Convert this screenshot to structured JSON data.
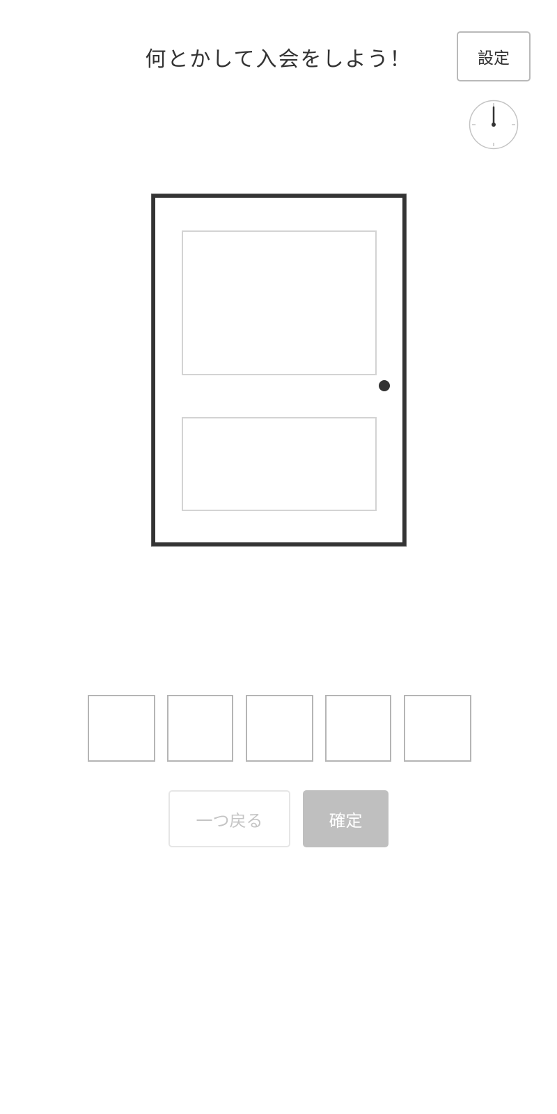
{
  "header": {
    "title": "何とかして入会をしよう！",
    "settings_label": "設定"
  },
  "code_input": {
    "slot_count": 5,
    "values": [
      "",
      "",
      "",
      "",
      ""
    ]
  },
  "actions": {
    "back_label": "一つ戻る",
    "confirm_label": "確定"
  },
  "colors": {
    "text": "#333333",
    "door_frame": "#343434",
    "panel_border": "#d3d3d3",
    "slot_border": "#b5b5b5",
    "confirm_disabled_bg": "#bfbfbf",
    "back_disabled_text": "#c4c4c4"
  },
  "icons": {
    "timer": "clock-icon",
    "door_knob": "door-knob"
  }
}
